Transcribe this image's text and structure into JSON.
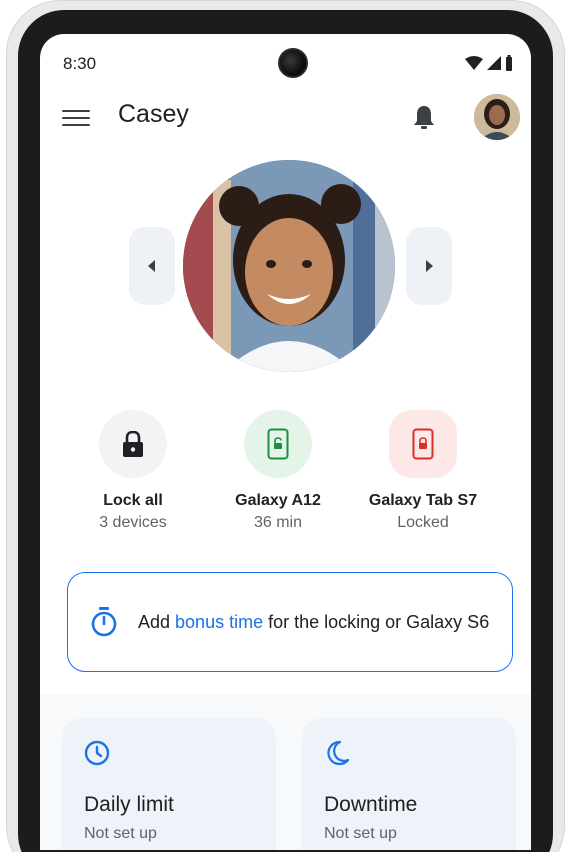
{
  "status_bar": {
    "time": "8:30",
    "icons": [
      "wifi-icon",
      "signal-icon",
      "battery-icon"
    ]
  },
  "app_bar": {
    "title": "Casey",
    "menu_icon": "menu-icon",
    "bell_icon": "bell-icon"
  },
  "carousel": {
    "prev_icon": "chevron-left-icon",
    "next_icon": "chevron-right-icon"
  },
  "devices": [
    {
      "name": "Lock all",
      "sub": "3 devices",
      "icon": "lock-icon",
      "status_color": "#202124"
    },
    {
      "name": "Galaxy A12",
      "sub": "36 min",
      "icon": "phone-unlocked-icon",
      "status_color": "#1e8e3e"
    },
    {
      "name": "Galaxy Tab S7",
      "sub": "Locked",
      "icon": "phone-locked-icon",
      "status_color": "#d93025"
    }
  ],
  "bonus": {
    "text_before": "Add ",
    "link": "bonus time",
    "text_after": " for the locking or Galaxy S6",
    "icon": "timer-icon"
  },
  "tiles": [
    {
      "title": "Daily limit",
      "sub": "Not set up",
      "icon": "clock-icon"
    },
    {
      "title": "Downtime",
      "sub": "Not set up",
      "icon": "moon-icon"
    }
  ],
  "colors": {
    "accent": "#1a73e8",
    "green": "#1e8e3e",
    "red": "#d93025"
  }
}
